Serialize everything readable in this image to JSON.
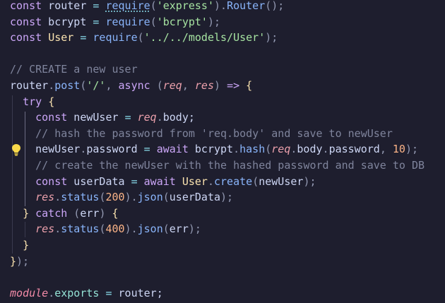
{
  "editor": {
    "language": "javascript",
    "lines": [
      [
        [
          "kw",
          "const"
        ],
        [
          "var",
          " router "
        ],
        [
          "op",
          "="
        ],
        [
          "var",
          " "
        ],
        [
          "fn",
          "require",
          "squiggle"
        ],
        [
          "pun",
          "("
        ],
        [
          "str",
          "'express'"
        ],
        [
          "pun",
          ")."
        ],
        [
          "fn",
          "Router"
        ],
        [
          "pun",
          "();"
        ]
      ],
      [
        [
          "kw",
          "const"
        ],
        [
          "var",
          " bcrypt "
        ],
        [
          "op",
          "="
        ],
        [
          "var",
          " "
        ],
        [
          "fn",
          "require"
        ],
        [
          "pun",
          "("
        ],
        [
          "str",
          "'bcrypt'"
        ],
        [
          "pun",
          ");"
        ]
      ],
      [
        [
          "kw",
          "const"
        ],
        [
          "var",
          " "
        ],
        [
          "cls",
          "User"
        ],
        [
          "var",
          " "
        ],
        [
          "op",
          "="
        ],
        [
          "var",
          " "
        ],
        [
          "fn",
          "require"
        ],
        [
          "pun",
          "("
        ],
        [
          "str",
          "'../../models/User'"
        ],
        [
          "pun",
          ");"
        ]
      ],
      [],
      [
        [
          "cmt",
          "// CREATE a new user"
        ]
      ],
      [
        [
          "var",
          "router"
        ],
        [
          "pun",
          "."
        ],
        [
          "fn",
          "post"
        ],
        [
          "pun",
          "("
        ],
        [
          "str",
          "'/'"
        ],
        [
          "pun",
          ", "
        ],
        [
          "kw",
          "async"
        ],
        [
          "pun",
          " ("
        ],
        [
          "par",
          "req"
        ],
        [
          "pun",
          ", "
        ],
        [
          "par",
          "res"
        ],
        [
          "pun",
          ") "
        ],
        [
          "kw",
          "=>"
        ],
        [
          "pun",
          " "
        ],
        [
          "brk",
          "{"
        ]
      ],
      [
        [
          "var",
          "  "
        ],
        [
          "kw",
          "try"
        ],
        [
          "pun",
          " "
        ],
        [
          "brk",
          "{"
        ]
      ],
      [
        [
          "var",
          "    "
        ],
        [
          "kw",
          "const"
        ],
        [
          "var",
          " newUser "
        ],
        [
          "op",
          "="
        ],
        [
          "var",
          " "
        ],
        [
          "par",
          "req"
        ],
        [
          "pun",
          "."
        ],
        [
          "var",
          "body;"
        ]
      ],
      [
        [
          "var",
          "    "
        ],
        [
          "cmt",
          "// hash the password from 'req.body' and save to newUser"
        ]
      ],
      [
        [
          "var",
          "    newUser"
        ],
        [
          "pun",
          "."
        ],
        [
          "var",
          "password "
        ],
        [
          "op",
          "="
        ],
        [
          "var",
          " "
        ],
        [
          "kw",
          "await"
        ],
        [
          "var",
          " bcrypt"
        ],
        [
          "pun",
          "."
        ],
        [
          "fn",
          "hash"
        ],
        [
          "pun",
          "("
        ],
        [
          "par",
          "req"
        ],
        [
          "pun",
          "."
        ],
        [
          "var",
          "body"
        ],
        [
          "pun",
          "."
        ],
        [
          "var",
          "password"
        ],
        [
          "pun",
          ", "
        ],
        [
          "num",
          "10"
        ],
        [
          "pun",
          ");"
        ]
      ],
      [
        [
          "var",
          "    "
        ],
        [
          "cmt",
          "// create the newUser with the hashed password and save to DB"
        ]
      ],
      [
        [
          "var",
          "    "
        ],
        [
          "kw",
          "const"
        ],
        [
          "var",
          " userData "
        ],
        [
          "op",
          "="
        ],
        [
          "var",
          " "
        ],
        [
          "kw",
          "await"
        ],
        [
          "var",
          " "
        ],
        [
          "cls",
          "User"
        ],
        [
          "pun",
          "."
        ],
        [
          "fn",
          "create"
        ],
        [
          "pun",
          "("
        ],
        [
          "var",
          "newUser"
        ],
        [
          "pun",
          ");"
        ]
      ],
      [
        [
          "var",
          "    "
        ],
        [
          "par",
          "res"
        ],
        [
          "pun",
          "."
        ],
        [
          "fn",
          "status"
        ],
        [
          "pun",
          "("
        ],
        [
          "num",
          "200"
        ],
        [
          "pun",
          ")."
        ],
        [
          "fn",
          "json"
        ],
        [
          "pun",
          "("
        ],
        [
          "var",
          "userData"
        ],
        [
          "pun",
          ");"
        ]
      ],
      [
        [
          "var",
          "  "
        ],
        [
          "brk",
          "}"
        ],
        [
          "var",
          " "
        ],
        [
          "kw",
          "catch"
        ],
        [
          "pun",
          " ("
        ],
        [
          "var",
          "err"
        ],
        [
          "pun",
          ") "
        ],
        [
          "brk",
          "{"
        ]
      ],
      [
        [
          "var",
          "    "
        ],
        [
          "par",
          "res"
        ],
        [
          "pun",
          "."
        ],
        [
          "fn",
          "status"
        ],
        [
          "pun",
          "("
        ],
        [
          "num",
          "400"
        ],
        [
          "pun",
          ")."
        ],
        [
          "fn",
          "json"
        ],
        [
          "pun",
          "("
        ],
        [
          "var",
          "err"
        ],
        [
          "pun",
          ");"
        ]
      ],
      [
        [
          "var",
          "  "
        ],
        [
          "brk",
          "}"
        ]
      ],
      [
        [
          "brk",
          "}"
        ],
        [
          "pun",
          ");"
        ]
      ],
      [],
      [
        [
          "mod",
          "module"
        ],
        [
          "pun",
          "."
        ],
        [
          "prop",
          "exports"
        ],
        [
          "var",
          " "
        ],
        [
          "op",
          "="
        ],
        [
          "var",
          " router;"
        ]
      ]
    ]
  },
  "colors": {
    "background": "#1e1e2e",
    "lightbulb": "#f9d94a"
  },
  "icons": {
    "lightbulb": "lightbulb-icon"
  }
}
